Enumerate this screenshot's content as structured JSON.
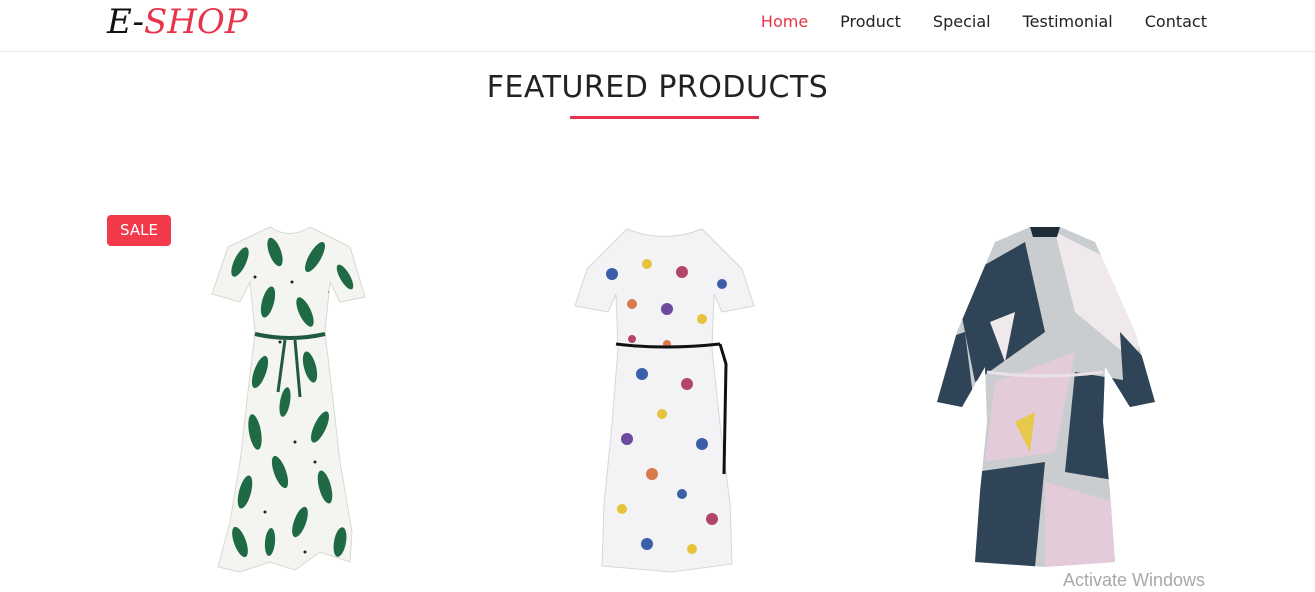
{
  "brand": {
    "prefix": "E-",
    "name": "SHOP"
  },
  "nav": {
    "items": [
      {
        "label": "Home",
        "active": true
      },
      {
        "label": "Product"
      },
      {
        "label": "Special"
      },
      {
        "label": "Testimonial"
      },
      {
        "label": "Contact"
      }
    ]
  },
  "section": {
    "title": "FEATURED PRODUCTS"
  },
  "products": [
    {
      "badge": "SALE",
      "image": "leaf-print-dress"
    },
    {
      "image": "floral-print-dress"
    },
    {
      "image": "abstract-print-dress"
    }
  ],
  "colors": {
    "accent": "#e8344a",
    "badge": "#f23a4b",
    "text": "#222222"
  },
  "os_watermark": {
    "text": "Activate Windows"
  }
}
